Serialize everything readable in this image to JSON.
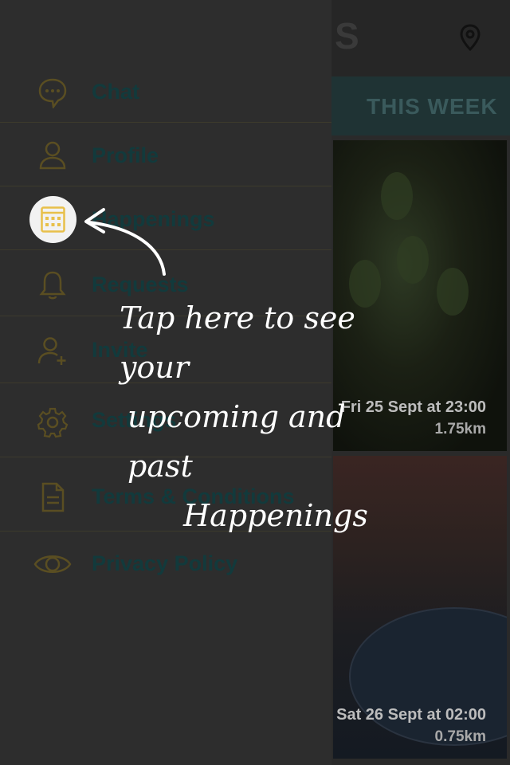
{
  "background": {
    "tab_label": "THIS WEEK",
    "logo_partial": "S",
    "cards": [
      {
        "date": "Fri 25 Sept at 23:00",
        "distance": "1.75km"
      },
      {
        "date": "Sat 26 Sept at 02:00",
        "distance": "0.75km"
      }
    ]
  },
  "menu": {
    "items": [
      {
        "label": "Chat",
        "icon": "chat-bubble-icon"
      },
      {
        "label": "Profile",
        "icon": "person-icon"
      },
      {
        "label": "Happenings",
        "icon": "calendar-icon"
      },
      {
        "label": "Requests",
        "icon": "bell-icon"
      },
      {
        "label": "Invite",
        "icon": "add-person-icon"
      },
      {
        "label": "Settings",
        "icon": "gear-icon"
      },
      {
        "label": "Terms & Conditions",
        "icon": "document-icon"
      },
      {
        "label": "Privacy Policy",
        "icon": "eye-icon"
      }
    ]
  },
  "coach_mark": {
    "line1": "Tap here to see your",
    "line2": "upcoming and past",
    "line3": "Happenings"
  },
  "colors": {
    "menu_text": "#123a3c",
    "icon_gold": "#5a4e22",
    "highlight_icon": "#e8c04a",
    "overlay_text": "#ffffff"
  }
}
